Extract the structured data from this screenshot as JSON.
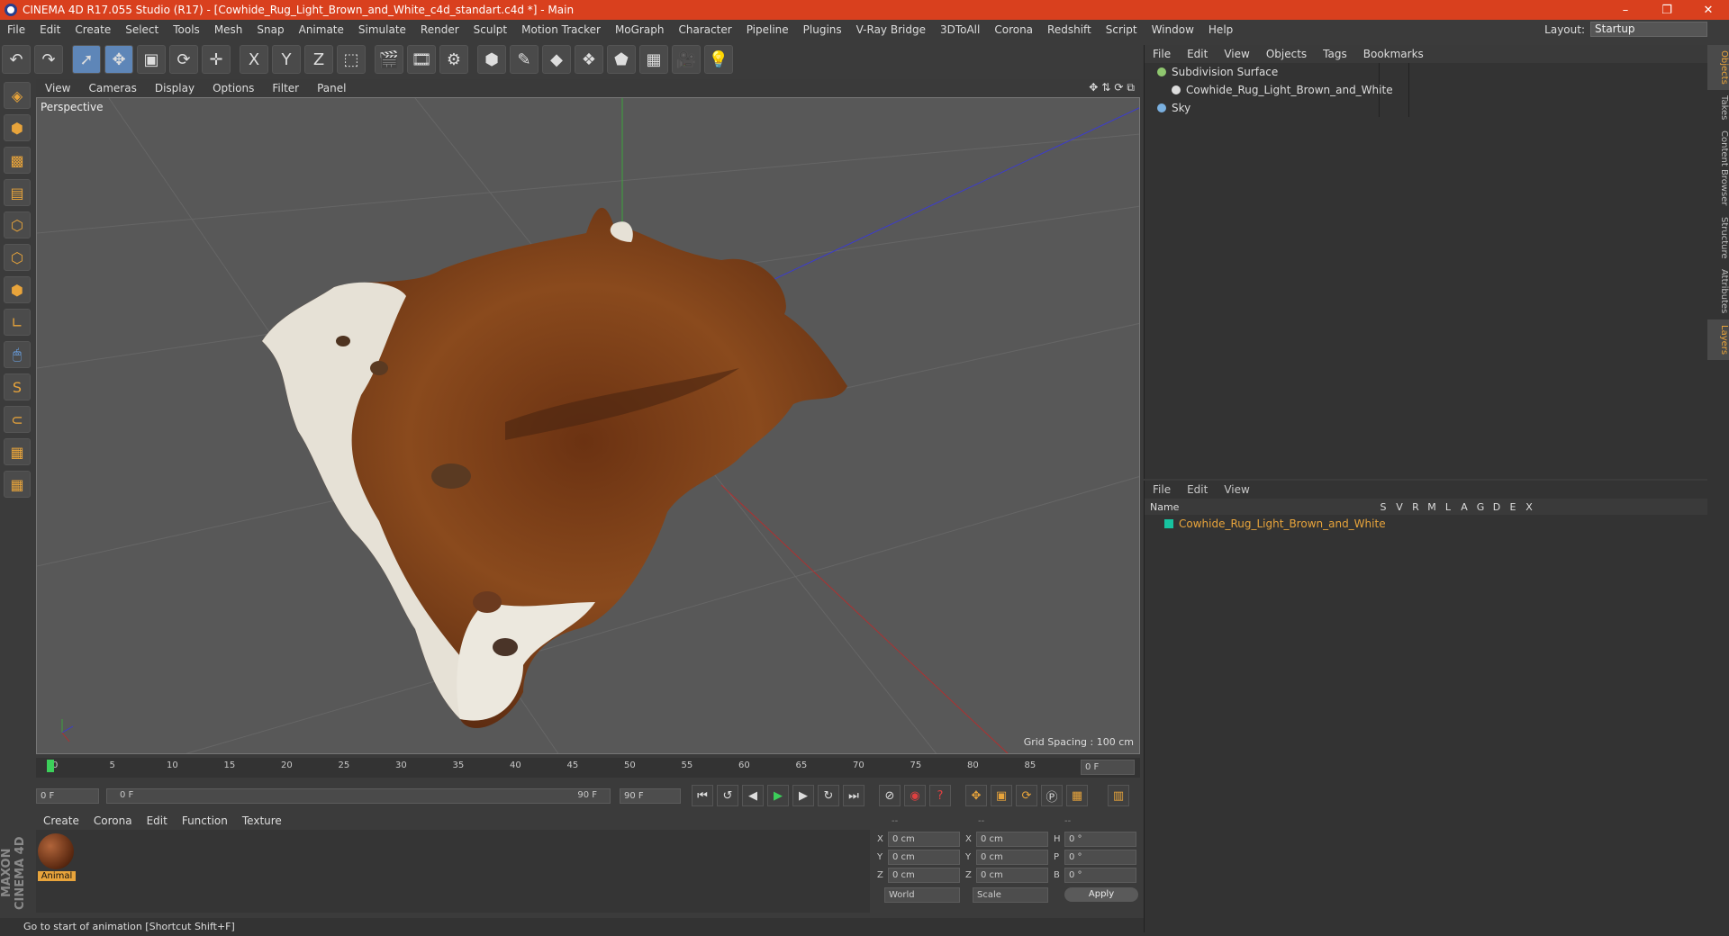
{
  "window": {
    "title": "CINEMA 4D R17.055 Studio (R17) - [Cowhide_Rug_Light_Brown_and_White_c4d_standart.c4d *] - Main",
    "minimize": "–",
    "restore": "❐",
    "close": "✕"
  },
  "menu": [
    "File",
    "Edit",
    "Create",
    "Select",
    "Tools",
    "Mesh",
    "Snap",
    "Animate",
    "Simulate",
    "Render",
    "Sculpt",
    "Motion Tracker",
    "MoGraph",
    "Character",
    "Pipeline",
    "Plugins",
    "V-Ray Bridge",
    "3DToAll",
    "Corona",
    "Redshift",
    "Script",
    "Window",
    "Help"
  ],
  "layout": {
    "label": "Layout:",
    "value": "Startup"
  },
  "toolbar": {
    "icons": [
      "undo-icon",
      "redo-icon",
      "select-arrow-icon",
      "move-icon",
      "scale-icon",
      "rotate-icon",
      "transform-icon",
      "x-axis-icon",
      "y-axis-icon",
      "z-axis-icon",
      "world-coord-icon",
      "render-view-icon",
      "render-region-icon",
      "render-settings-icon",
      "cube-icon",
      "pen-spline-icon",
      "subdivision-icon",
      "array-icon",
      "deformer-icon",
      "floor-grid-icon",
      "camera-icon",
      "light-icon"
    ],
    "glyphs": [
      "↶",
      "↷",
      "➚",
      "✥",
      "▣",
      "⟳",
      "✛",
      "X",
      "Y",
      "Z",
      "⬚",
      "🎬",
      "🎞",
      "⚙",
      "⬢",
      "✎",
      "◆",
      "❖",
      "⬟",
      "▦",
      "🎥",
      "💡"
    ]
  },
  "lefttools": [
    {
      "icon": "make-editable-icon",
      "g": "◈"
    },
    {
      "icon": "model-mode-icon",
      "g": "⬢"
    },
    {
      "icon": "texture-mode-icon",
      "g": "▩"
    },
    {
      "icon": "workplane-mode-icon",
      "g": "▤"
    },
    {
      "icon": "points-mode-icon",
      "g": "⬡"
    },
    {
      "icon": "edges-mode-icon",
      "g": "⬡"
    },
    {
      "icon": "polygons-mode-icon",
      "g": "⬢"
    },
    {
      "icon": "axis-mode-icon",
      "g": "∟"
    },
    {
      "icon": "tweak-mode-icon",
      "g": "🖱"
    },
    {
      "icon": "snap-s-icon",
      "g": "S"
    },
    {
      "icon": "magnet-icon",
      "g": "⊂"
    },
    {
      "icon": "grid-lock-icon",
      "g": "▦"
    },
    {
      "icon": "grid-snap-icon",
      "g": "▦"
    }
  ],
  "viewport": {
    "menu": [
      "View",
      "Cameras",
      "Display",
      "Options",
      "Filter",
      "Panel"
    ],
    "label": "Perspective",
    "grid": "Grid Spacing : 100 cm",
    "navicons": [
      "✥",
      "⇅",
      "⟳",
      "⧉"
    ]
  },
  "timeline": {
    "ticks": [
      "0",
      "5",
      "10",
      "15",
      "20",
      "25",
      "30",
      "35",
      "40",
      "45",
      "50",
      "55",
      "60",
      "65",
      "70",
      "75",
      "80",
      "85",
      "90"
    ],
    "frame": "0 F"
  },
  "transport": {
    "start": "0 F",
    "rangeStart": "0 F",
    "rangeEnd": "90 F",
    "end": "90 F"
  },
  "materials": {
    "menu": [
      "Create",
      "Corona",
      "Edit",
      "Function",
      "Texture"
    ],
    "items": [
      {
        "name": "Animal"
      }
    ]
  },
  "coords": {
    "headers": [
      "--",
      "--",
      "--"
    ],
    "rows": [
      {
        "a": "X",
        "av": "0 cm",
        "b": "X",
        "bv": "0 cm",
        "c": "H",
        "cv": "0 °"
      },
      {
        "a": "Y",
        "av": "0 cm",
        "b": "Y",
        "bv": "0 cm",
        "c": "P",
        "cv": "0 °"
      },
      {
        "a": "Z",
        "av": "0 cm",
        "b": "Z",
        "bv": "0 cm",
        "c": "B",
        "cv": "0 °"
      }
    ],
    "world": "World",
    "scale": "Scale",
    "apply": "Apply"
  },
  "objects": {
    "menu": [
      "File",
      "Edit",
      "View",
      "Objects",
      "Tags",
      "Bookmarks"
    ],
    "items": [
      {
        "name": "Subdivision Surface",
        "color": "#8fc76f"
      },
      {
        "name": "Cowhide_Rug_Light_Brown_and_White",
        "color": "#dddddd"
      },
      {
        "name": "Sky",
        "color": "#7ab0e0"
      }
    ]
  },
  "layers": {
    "menu": [
      "File",
      "Edit",
      "View"
    ],
    "cols": {
      "name": "Name",
      "flags": [
        "S",
        "V",
        "R",
        "M",
        "L",
        "A",
        "G",
        "D",
        "E",
        "X"
      ]
    },
    "items": [
      {
        "name": "Cowhide_Rug_Light_Brown_and_White",
        "color": "#17c3a0"
      }
    ]
  },
  "righttabs": [
    "Objects",
    "Takes",
    "Content Browser",
    "Structure",
    "Attributes",
    "Layers"
  ],
  "status": "Go to start of animation [Shortcut Shift+F]",
  "maxon": "MAXON CINEMA 4D",
  "colors": {
    "accent": "#d9401e",
    "orange": "#e8a43b",
    "teal": "#17c3a0"
  }
}
